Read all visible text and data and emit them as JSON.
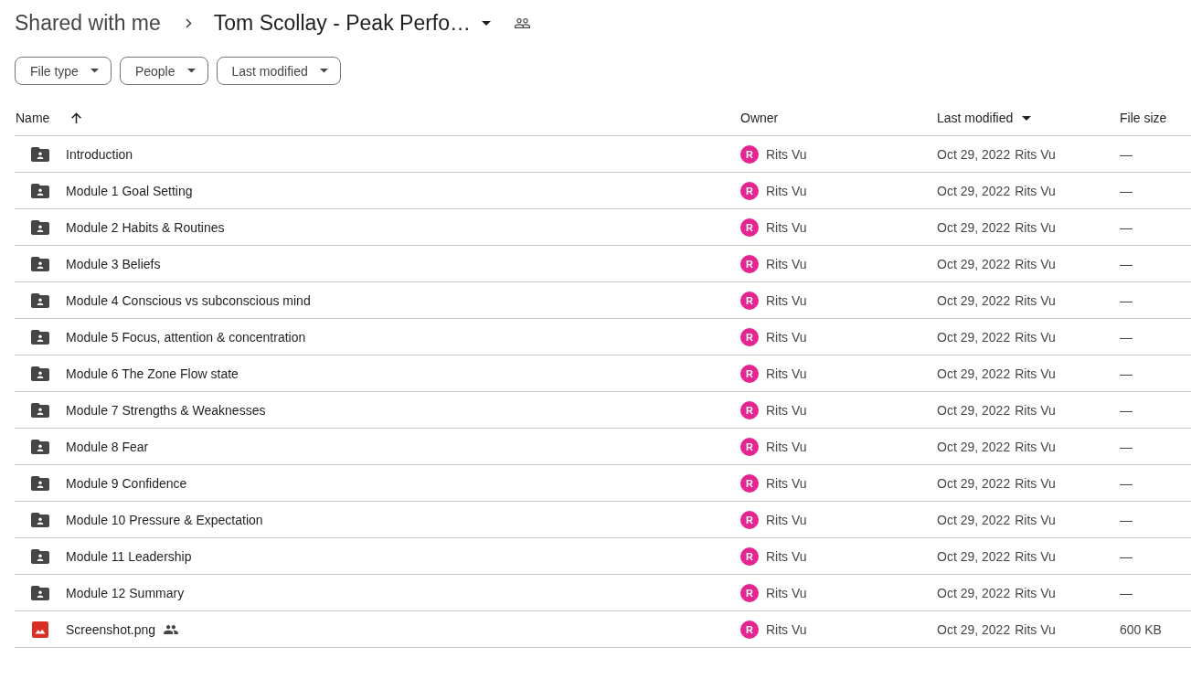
{
  "breadcrumb": {
    "parent": "Shared with me",
    "current": "Tom Scollay - Peak Perfo…"
  },
  "filters": [
    {
      "label": "File type"
    },
    {
      "label": "People"
    },
    {
      "label": "Last modified"
    }
  ],
  "table": {
    "columns": [
      {
        "label": "Name",
        "kind": "sort-arrow"
      },
      {
        "label": "Owner",
        "kind": "plain"
      },
      {
        "label": "Last modified",
        "kind": "menu"
      },
      {
        "label": "File size",
        "kind": "plain"
      }
    ],
    "rows": [
      {
        "name": "Introduction",
        "kind": "shared-folder",
        "shared": false,
        "owner_initial": "R",
        "owner": "Rits Vu",
        "modified": "Oct 29, 2022",
        "modified_by": "Rits Vu",
        "size": "—"
      },
      {
        "name": "Module 1 Goal Setting",
        "kind": "shared-folder",
        "shared": false,
        "owner_initial": "R",
        "owner": "Rits Vu",
        "modified": "Oct 29, 2022",
        "modified_by": "Rits Vu",
        "size": "—"
      },
      {
        "name": "Module 2 Habits & Routines",
        "kind": "shared-folder",
        "shared": false,
        "owner_initial": "R",
        "owner": "Rits Vu",
        "modified": "Oct 29, 2022",
        "modified_by": "Rits Vu",
        "size": "—"
      },
      {
        "name": "Module 3 Beliefs",
        "kind": "shared-folder",
        "shared": false,
        "owner_initial": "R",
        "owner": "Rits Vu",
        "modified": "Oct 29, 2022",
        "modified_by": "Rits Vu",
        "size": "—"
      },
      {
        "name": "Module 4 Conscious vs subconscious mind",
        "kind": "shared-folder",
        "shared": false,
        "owner_initial": "R",
        "owner": "Rits Vu",
        "modified": "Oct 29, 2022",
        "modified_by": "Rits Vu",
        "size": "—"
      },
      {
        "name": "Module 5 Focus, attention & concentration",
        "kind": "shared-folder",
        "shared": false,
        "owner_initial": "R",
        "owner": "Rits Vu",
        "modified": "Oct 29, 2022",
        "modified_by": "Rits Vu",
        "size": "—"
      },
      {
        "name": "Module 6 The Zone Flow state",
        "kind": "shared-folder",
        "shared": false,
        "owner_initial": "R",
        "owner": "Rits Vu",
        "modified": "Oct 29, 2022",
        "modified_by": "Rits Vu",
        "size": "—"
      },
      {
        "name": "Module 7 Strengths & Weaknesses",
        "kind": "shared-folder",
        "shared": false,
        "owner_initial": "R",
        "owner": "Rits Vu",
        "modified": "Oct 29, 2022",
        "modified_by": "Rits Vu",
        "size": "—"
      },
      {
        "name": "Module 8 Fear",
        "kind": "shared-folder",
        "shared": false,
        "owner_initial": "R",
        "owner": "Rits Vu",
        "modified": "Oct 29, 2022",
        "modified_by": "Rits Vu",
        "size": "—"
      },
      {
        "name": "Module 9 Confidence",
        "kind": "shared-folder",
        "shared": false,
        "owner_initial": "R",
        "owner": "Rits Vu",
        "modified": "Oct 29, 2022",
        "modified_by": "Rits Vu",
        "size": "—"
      },
      {
        "name": "Module 10 Pressure & Expectation",
        "kind": "shared-folder",
        "shared": false,
        "owner_initial": "R",
        "owner": "Rits Vu",
        "modified": "Oct 29, 2022",
        "modified_by": "Rits Vu",
        "size": "—"
      },
      {
        "name": "Module 11 Leadership",
        "kind": "shared-folder",
        "shared": false,
        "owner_initial": "R",
        "owner": "Rits Vu",
        "modified": "Oct 29, 2022",
        "modified_by": "Rits Vu",
        "size": "—"
      },
      {
        "name": "Module 12 Summary",
        "kind": "shared-folder",
        "shared": false,
        "owner_initial": "R",
        "owner": "Rits Vu",
        "modified": "Oct 29, 2022",
        "modified_by": "Rits Vu",
        "size": "—"
      },
      {
        "name": "Screenshot.png",
        "kind": "image",
        "shared": true,
        "owner_initial": "R",
        "owner": "Rits Vu",
        "modified": "Oct 29, 2022",
        "modified_by": "Rits Vu",
        "size": "600 KB"
      }
    ]
  }
}
